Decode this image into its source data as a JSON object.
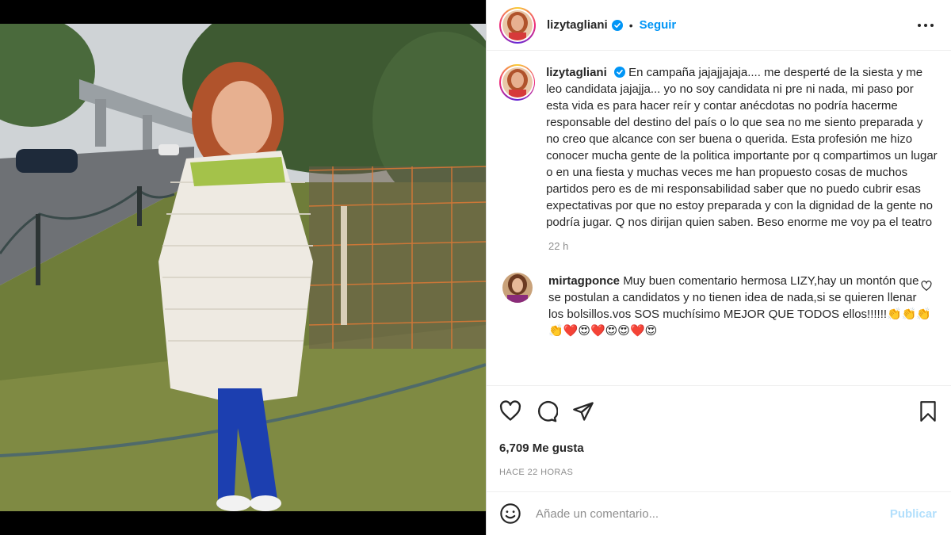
{
  "post": {
    "username": "lizytagliani",
    "follow_label": "Seguir",
    "dot": "•",
    "caption_username": "lizytagliani",
    "caption_text": "En campaña jajajjajaja.... me desperté de la siesta y me leo candidata jajajja... yo no soy candidata ni pre ni nada, mi paso por esta vida es para hacer reír y contar anécdotas no podría hacerme responsable del destino del país o lo que sea no me siento preparada y no creo que alcance con ser buena o querida. Esta profesión me hizo conocer mucha gente de la politica importante por q compartimos un lugar o en una fiesta y muchas veces me han propuesto cosas de muchos partidos pero es de mi responsabilidad saber que no puedo cubrir esas expectativas por que no estoy preparada y con la dignidad de la gente no podría jugar. Q nos dirijan quien saben. Beso enorme me voy pa el teatro",
    "caption_time": "22 h",
    "comments": [
      {
        "username": "mirtagponce",
        "text": "Muy buen comentario hermosa LIZY,hay un montón que se postulan a candidatos y no tienen idea de nada,si se quieren llenar los bolsillos.vos SOS muchísimo MEJOR QUE TODOS ellos!!!!!!👏👏👏👏❤️😍❤️😍😍❤️😍"
      }
    ],
    "likes": "6,709 Me gusta",
    "timestamp": "HACE 22 HORAS",
    "comment_placeholder": "Añade un comentario...",
    "publish_label": "Publicar"
  },
  "icons": {
    "verified": "verified-badge-icon",
    "more": "more-options-icon",
    "like": "heart-icon",
    "comment": "comment-icon",
    "share": "share-icon",
    "save": "bookmark-icon",
    "emoji": "emoji-icon"
  },
  "colors": {
    "accent": "#0095f6",
    "publish_disabled": "#b2dffc",
    "muted": "#8e8e8e",
    "text": "#262626"
  }
}
